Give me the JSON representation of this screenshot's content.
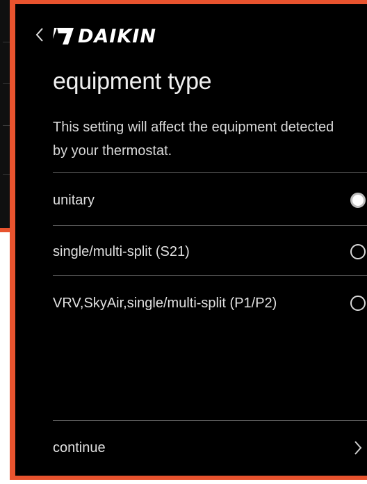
{
  "header": {
    "back_icon": "chevron-left-icon",
    "logo_text": "DAIKIN"
  },
  "page": {
    "title": "equipment type",
    "description": "This setting will affect the equipment detected by your thermostat."
  },
  "options": [
    {
      "label": "unitary",
      "selected": true
    },
    {
      "label": "single/multi-split (S21)",
      "selected": false
    },
    {
      "label": "VRV,SkyAir,single/multi-split (P1/P2)",
      "selected": false
    }
  ],
  "footer": {
    "continue_label": "continue",
    "continue_icon": "chevron-right-icon"
  },
  "colors": {
    "frame_accent": "#e8532e",
    "background": "#000000",
    "text": "#e0e0e0"
  }
}
